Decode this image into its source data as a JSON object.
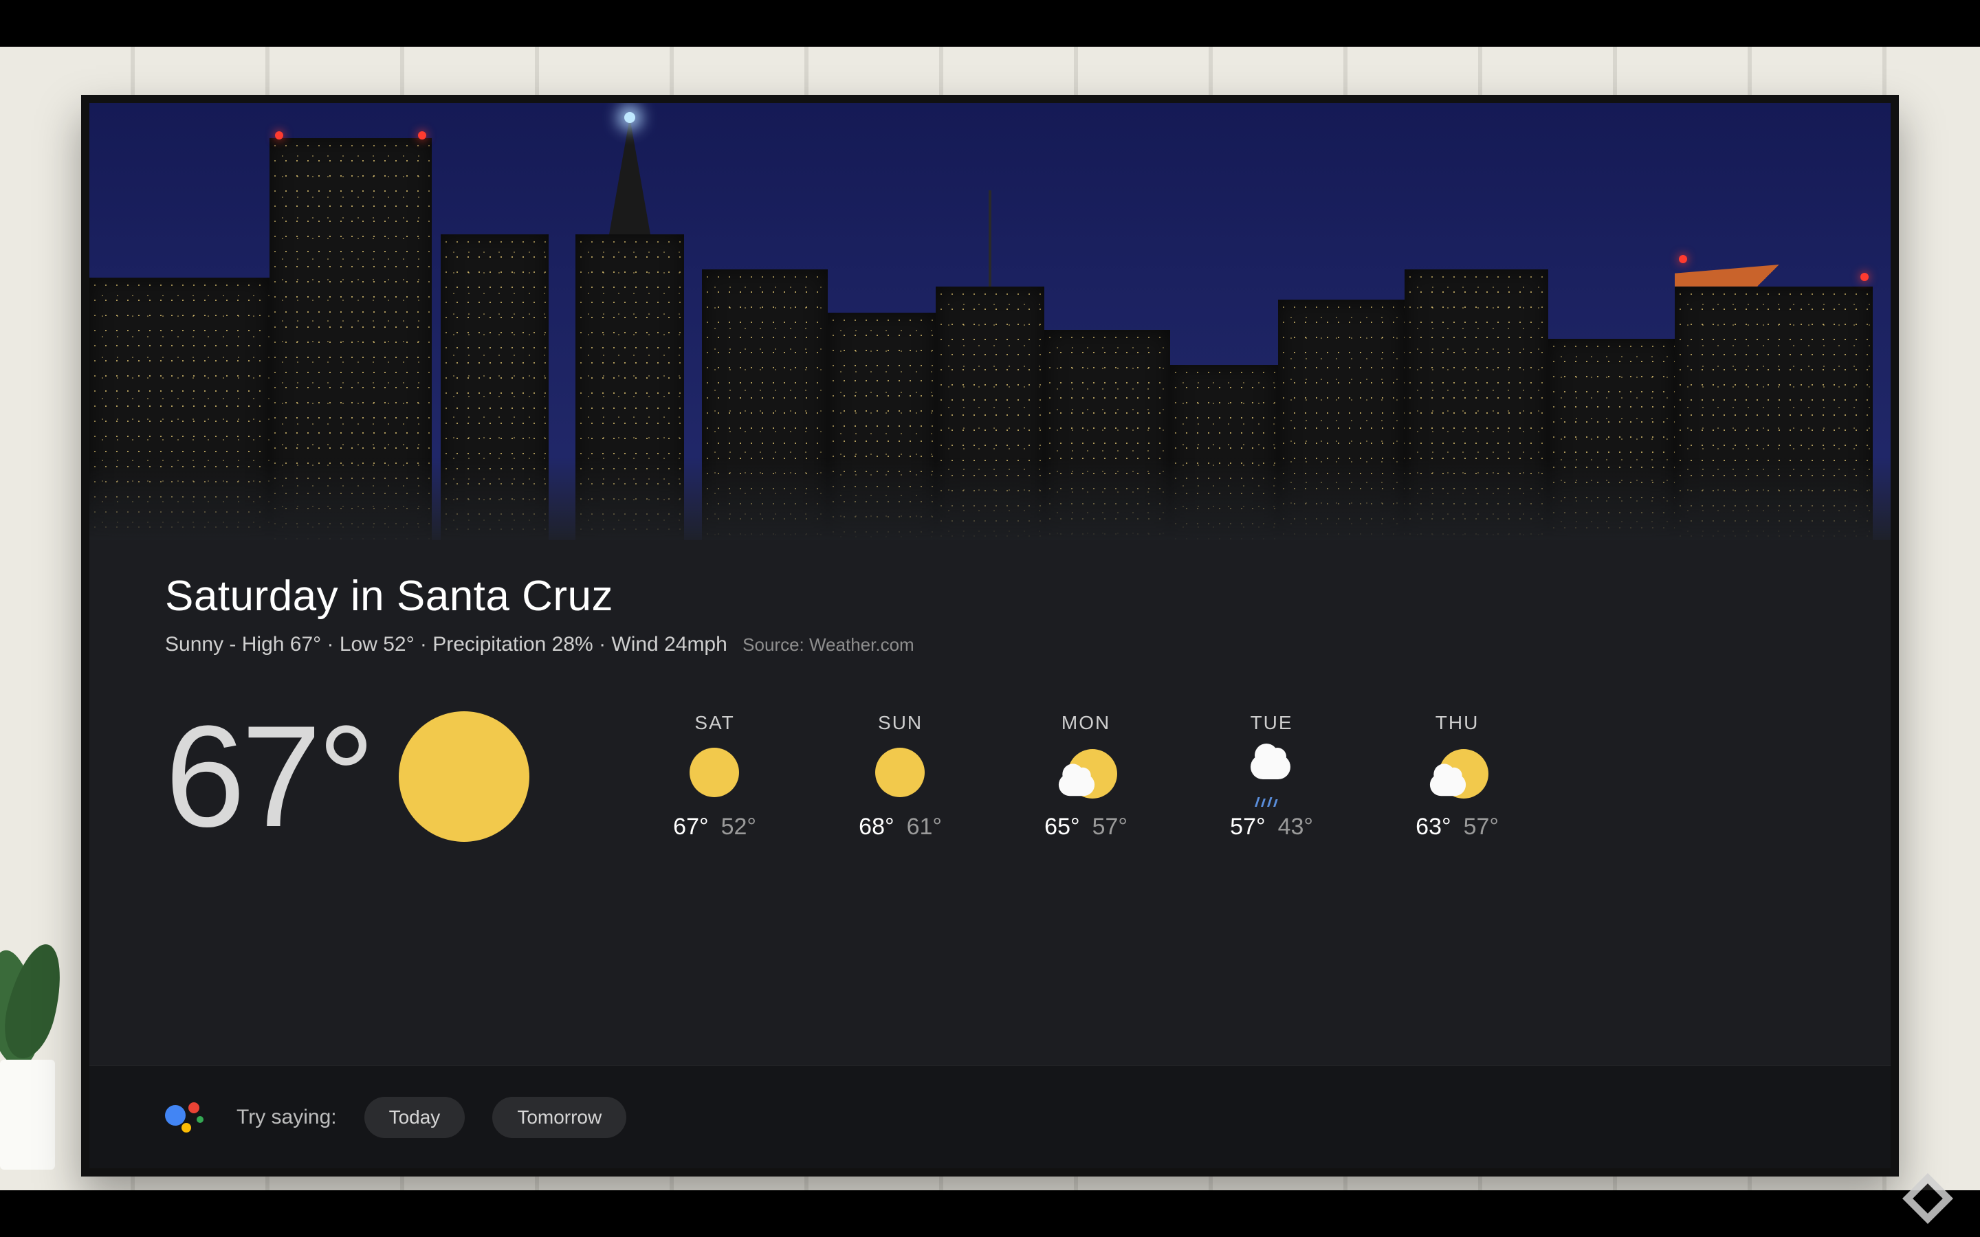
{
  "header": {
    "title": "Saturday in Santa Cruz",
    "condition": "Sunny",
    "high_label": "High 67°",
    "low_label": "Low 52°",
    "precip_label": "Precipitation 28%",
    "wind_label": "Wind 24mph",
    "source_label": "Source: Weather.com"
  },
  "current": {
    "temp": "67°",
    "icon": "sunny"
  },
  "forecast": [
    {
      "day": "SAT",
      "icon": "sunny",
      "hi": "67°",
      "lo": "52°"
    },
    {
      "day": "SUN",
      "icon": "sunny",
      "hi": "68°",
      "lo": "61°"
    },
    {
      "day": "MON",
      "icon": "partly-cloudy",
      "hi": "65°",
      "lo": "57°"
    },
    {
      "day": "TUE",
      "icon": "rain",
      "hi": "57°",
      "lo": "43°"
    },
    {
      "day": "THU",
      "icon": "partly-cloudy",
      "hi": "63°",
      "lo": "57°"
    }
  ],
  "assistant": {
    "prompt": "Try saying:",
    "chips": [
      "Today",
      "Tomorrow"
    ]
  },
  "colors": {
    "sun": "#f2c94c",
    "cloud": "#fafafa",
    "rain": "#5a8edc"
  }
}
